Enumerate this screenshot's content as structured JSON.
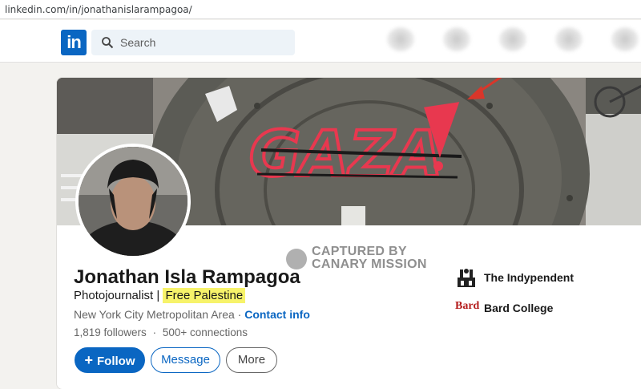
{
  "browser": {
    "url": "linkedin.com/in/jonathanislarampagoa/"
  },
  "nav": {
    "logo_text": "in",
    "search_placeholder": "Search",
    "brand_color": "#0a66c2"
  },
  "banner": {
    "graffiti_text": "GAZA",
    "graffiti_color": "#e8384f",
    "arrow_color": "#d9362a"
  },
  "watermark": {
    "line1": "CAPTURED BY",
    "line2": "CANARY MISSION"
  },
  "profile": {
    "name": "Jonathan Isla Rampagoa",
    "headline_prefix": "Photojournalist |",
    "headline_highlight": "Free Palestine",
    "location": "New York City Metropolitan Area",
    "location_separator": "·",
    "contact_link": "Contact info",
    "followers": "1,819 followers",
    "stats_separator": "·",
    "connections": "500+ connections"
  },
  "actions": {
    "follow_icon": "+",
    "follow_label": "Follow",
    "message_label": "Message",
    "more_label": "More"
  },
  "organizations": [
    {
      "name": "The Indypendent",
      "icon": "indypendent-logo"
    },
    {
      "name": "Bard College",
      "logo_text": "Bard",
      "icon": "bard-logo"
    }
  ]
}
